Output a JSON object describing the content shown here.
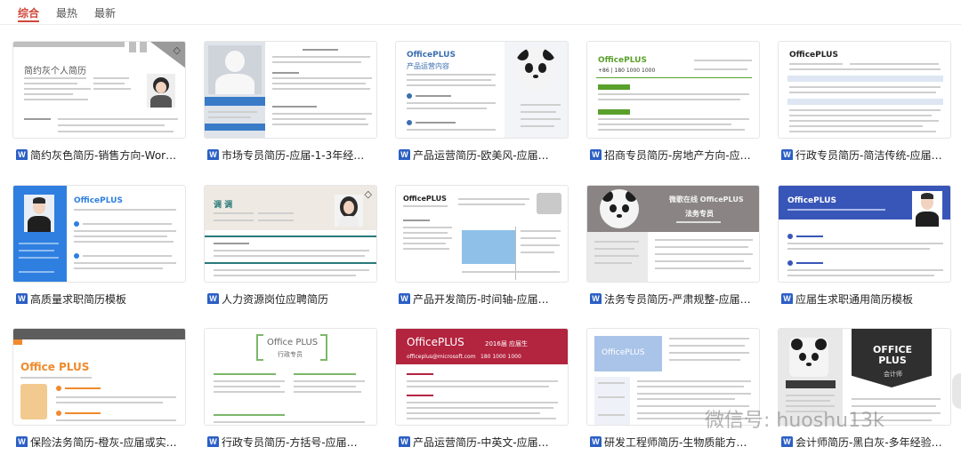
{
  "tabs": [
    {
      "label": "综合",
      "active": true
    },
    {
      "label": "最热",
      "active": false
    },
    {
      "label": "最新",
      "active": false
    }
  ],
  "accent": "#d0473a",
  "file_icon_letter": "W",
  "cards": [
    {
      "title": "简约灰色简历-销售方向-Wor…",
      "thumb_text": "简约灰个人简历"
    },
    {
      "title": "市场专员简历-应届-1-3年经…",
      "thumb_text": "求职意向：市场专员"
    },
    {
      "title": "产品运营简历-欧美风-应届…",
      "thumb_text": "OfficePLUS",
      "thumb_sub": "产品运营内容"
    },
    {
      "title": "招商专员简历-房地产方向-应…",
      "thumb_text": "OfficePLUS",
      "thumb_sub": "+86 | 180 1000 1000"
    },
    {
      "title": "行政专员简历-简洁传统-应届…",
      "thumb_text": "OfficePLUS"
    },
    {
      "title": "高质量求职简历模板",
      "thumb_text": "OfficePLUS"
    },
    {
      "title": "人力资源岗位应聘简历",
      "thumb_text": "调 调"
    },
    {
      "title": "产品开发简历-时间轴-应届…",
      "thumb_text": "OfficePLUS"
    },
    {
      "title": "法务专员简历-严肃规整-应届…",
      "thumb_text": "微歌在线 OfficePLUS",
      "thumb_sub": "法务专员"
    },
    {
      "title": "应届生求职通用简历模板",
      "thumb_text": "OfficePLUS"
    },
    {
      "title": "保险法务简历-橙灰-应届或实…",
      "thumb_text": "Office PLUS"
    },
    {
      "title": "行政专员简历-方括号-应届…",
      "thumb_text": "Office PLUS",
      "thumb_sub": "行政专员"
    },
    {
      "title": "产品运营简历-中英文-应届…",
      "thumb_text": "OfficePLUS",
      "thumb_sub": "2016届 应届生",
      "thumb_contact": "officeplus@microsoft.com",
      "thumb_phone": "180 1000 1000"
    },
    {
      "title": "研发工程师简历-生物质能方…",
      "thumb_text": "OfficePLUS"
    },
    {
      "title": "会计师简历-黑白灰-多年经验…",
      "thumb_text": "OFFICE PLUS",
      "thumb_sub": "会计师"
    }
  ],
  "watermark": "微信号: huoshu13k"
}
